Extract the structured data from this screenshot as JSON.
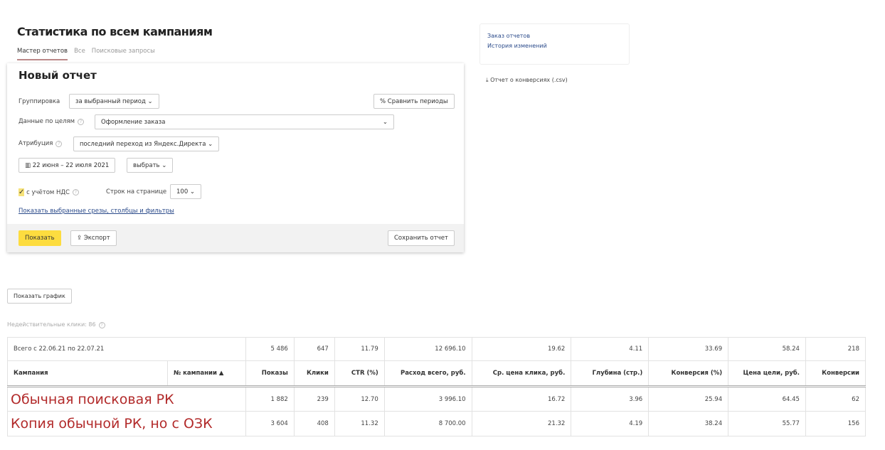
{
  "page_title": "Статистика по всем кампаниям",
  "tabs": [
    {
      "label": "Мастер отчетов",
      "active": true
    },
    {
      "label": "Все"
    },
    {
      "label": "Поисковые запросы"
    }
  ],
  "form": {
    "title": "Новый отчет",
    "grouping_label": "Группировка",
    "grouping_value": "за выбранный период",
    "compare_button": "Сравнить периоды",
    "goals_label": "Данные по целям",
    "goals_value": "Оформление заказа",
    "attribution_label": "Атрибуция",
    "attribution_value": "последний переход из Яндекс.Директа",
    "date_range": "22 июня – 22 июля 2021",
    "date_select": "выбрать",
    "vat_label": "с учётом НДС",
    "vat_checked": true,
    "rows_label": "Строк на странице",
    "rows_value": "100",
    "show_filters_link": "Показать выбранные срезы, столбцы и фильтры",
    "show_button": "Показать",
    "export_button": "Экспорт",
    "save_button": "Сохранить отчет"
  },
  "side": {
    "order_reports": "Заказ отчетов",
    "history": "История изменений",
    "conversions_csv": "Отчет о конверсиях (.csv)"
  },
  "show_chart_button": "Показать график",
  "invalid_clicks": "Недействительные клики: 86",
  "table": {
    "total": {
      "label": "Всего с 22.06.21 по 22.07.21",
      "values": [
        "5 486",
        "647",
        "11.79",
        "12 696.10",
        "19.62",
        "4.11",
        "33.69",
        "58.24",
        "218"
      ]
    },
    "headers": [
      "Кампания",
      "№ кампании ▲",
      "Показы",
      "Клики",
      "CTR (%)",
      "Расход всего, руб.",
      "Ср. цена клика, руб.",
      "Глубина (стр.)",
      "Конверсия (%)",
      "Цена цели, руб.",
      "Конверсии"
    ],
    "rows": [
      {
        "campaign": "Обычная поисковая РК",
        "values": [
          "1 882",
          "239",
          "12.70",
          "3 996.10",
          "16.72",
          "3.96",
          "25.94",
          "64.45",
          "62"
        ]
      },
      {
        "campaign": "Копия обычной РК, но с ОЗК",
        "values": [
          "3 604",
          "408",
          "11.32",
          "8 700.00",
          "21.32",
          "4.19",
          "38.24",
          "55.77",
          "156"
        ]
      }
    ]
  },
  "colors": {
    "accent_yellow": "#fddc3f",
    "link": "#2a4a8a",
    "annotation_red": "#b22a2a"
  }
}
